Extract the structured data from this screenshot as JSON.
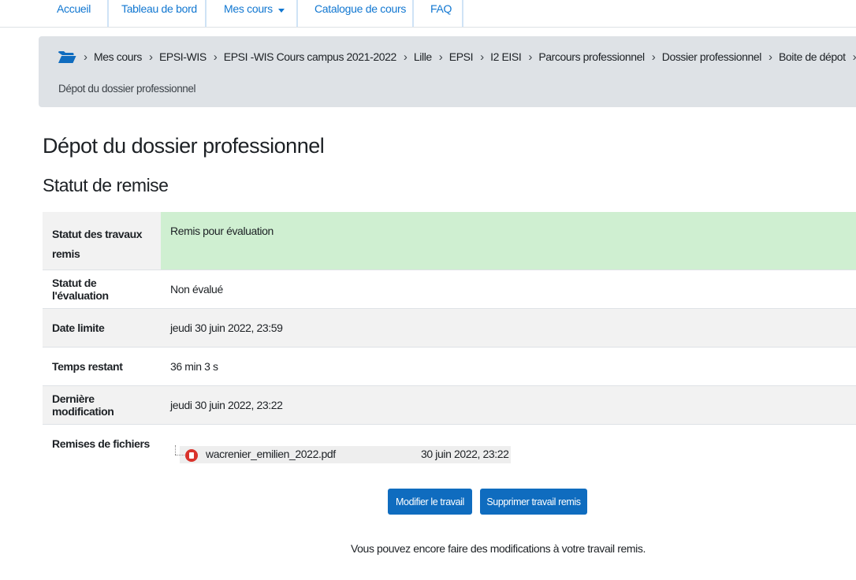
{
  "nav": {
    "items": [
      {
        "label": "Accueil"
      },
      {
        "label": "Tableau de bord"
      },
      {
        "label": "Mes cours"
      },
      {
        "label": "Catalogue de cours"
      },
      {
        "label": "FAQ"
      }
    ],
    "dropdown_icon": "caret-down-icon"
  },
  "breadcrumb": {
    "home_icon": "folder-open-icon",
    "items": [
      "Mes cours",
      "EPSI-WIS",
      "EPSI -WIS Cours campus 2021-2022",
      "Lille",
      "EPSI",
      "I2 EISI",
      "Parcours professionnel",
      "Dossier professionnel",
      "Boite de dépot"
    ],
    "current": "Dépot du dossier professionnel",
    "separator": "›"
  },
  "page": {
    "title": "Dépot du dossier professionnel",
    "section_title": "Statut de remise"
  },
  "status": {
    "rows": [
      {
        "label": "Statut des travaux remis",
        "value": "Remis pour évaluation"
      },
      {
        "label": "Statut de l'évaluation",
        "value": "Non évalué"
      },
      {
        "label": "Date limite",
        "value": "jeudi 30 juin 2022, 23:59"
      },
      {
        "label": "Temps restant",
        "value": "36 min 3 s"
      },
      {
        "label": "Dernière modification",
        "value": "jeudi 30 juin 2022, 23:22"
      },
      {
        "label": "Remises de fichiers",
        "value": ""
      }
    ],
    "file": {
      "name": "wacrenier_emilien_2022.pdf",
      "date": "30 juin 2022, 23:22",
      "icon": "pdf-file-icon"
    },
    "submitted_color": "#cfefd1"
  },
  "actions": {
    "edit_label": "Modifier le travail",
    "delete_label": "Supprimer travail remis"
  },
  "footer_note": "Vous pouvez encore faire des modifications à votre travail remis.",
  "colors": {
    "accent": "#0f6cbf",
    "link": "#1177d1",
    "breadcrumb_bg": "#dee2e6"
  }
}
